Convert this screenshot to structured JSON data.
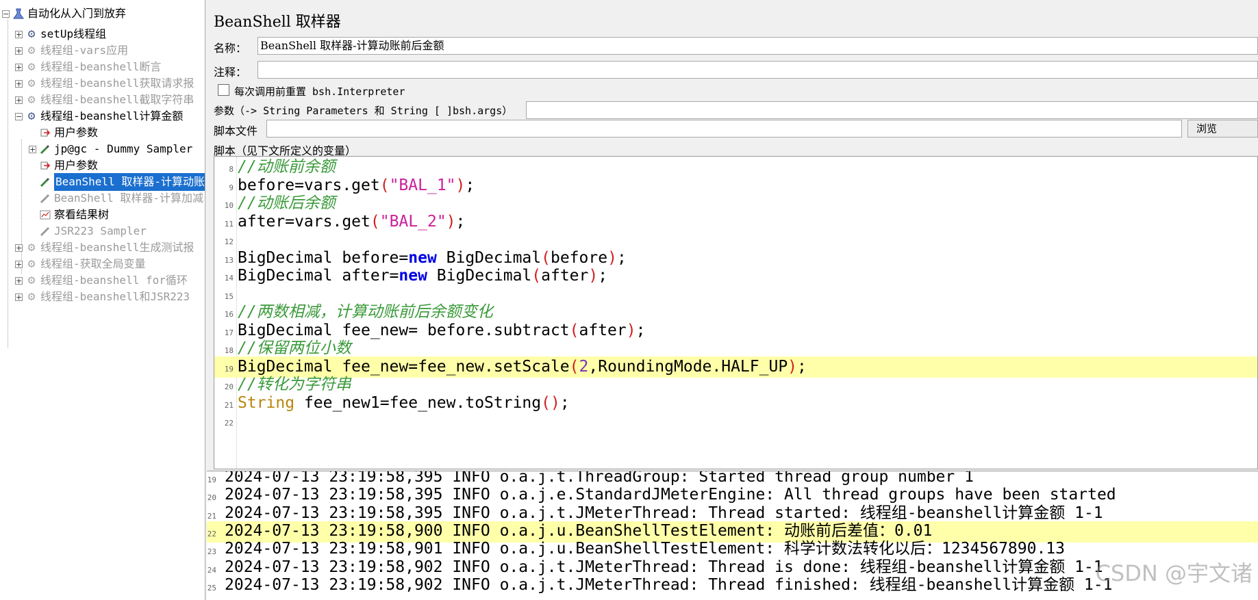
{
  "tree": {
    "root": "自动化从入门到放弃",
    "items": [
      {
        "label": "setUp线程组",
        "enabled": true
      },
      {
        "label": "线程组-vars应用",
        "enabled": false
      },
      {
        "label": "线程组-beanshell断言",
        "enabled": false
      },
      {
        "label": "线程组-beanshell获取请求报",
        "enabled": false
      },
      {
        "label": "线程组-beanshell截取字符串",
        "enabled": false
      },
      {
        "label": "线程组-beanshell计算金额",
        "enabled": true
      },
      {
        "label": "用户参数",
        "enabled": true
      },
      {
        "label": "jp@gc - Dummy Sampler",
        "enabled": true
      },
      {
        "label": "用户参数",
        "enabled": true
      },
      {
        "label": "BeanShell 取样器-计算动账",
        "enabled": true
      },
      {
        "label": "BeanShell 取样器-计算加减",
        "enabled": false
      },
      {
        "label": "察看结果树",
        "enabled": true
      },
      {
        "label": "JSR223 Sampler",
        "enabled": false
      },
      {
        "label": "线程组-beanshell生成测试报",
        "enabled": false
      },
      {
        "label": "线程组-获取全局变量",
        "enabled": false
      },
      {
        "label": "线程组-beanshell for循环",
        "enabled": false
      },
      {
        "label": "线程组-beanshell和JSR223",
        "enabled": false
      }
    ]
  },
  "panel": {
    "title": "BeanShell 取样器",
    "name_label": "名称：",
    "name_value": "BeanShell 取样器-计算动账前后金额",
    "comment_label": "注释：",
    "comment_value": "",
    "reset_label": "每次调用前重置 bsh.Interpreter",
    "params_label": "参数（-> String Parameters 和 String [ ]bsh.args）",
    "params_value": "",
    "script_file_label": "脚本文件",
    "script_file_value": "",
    "browse_label": "浏览",
    "script_label": "脚本（见下文所定义的变量）"
  },
  "editor": {
    "lines": [
      {
        "n": "8",
        "text": "//动账前余额"
      },
      {
        "n": "9",
        "text": "before=vars.get(\"BAL_1\");"
      },
      {
        "n": "10",
        "text": "//动账后余额"
      },
      {
        "n": "11",
        "text": "after=vars.get(\"BAL_2\");"
      },
      {
        "n": "12",
        "text": ""
      },
      {
        "n": "13",
        "text": "BigDecimal before=new BigDecimal(before);"
      },
      {
        "n": "14",
        "text": "BigDecimal after=new BigDecimal(after);"
      },
      {
        "n": "15",
        "text": ""
      },
      {
        "n": "16",
        "text": "//两数相减，计算动账前后余额变化"
      },
      {
        "n": "17",
        "text": "BigDecimal fee_new= before.subtract(after);"
      },
      {
        "n": "18",
        "text": "//保留两位小数"
      },
      {
        "n": "19",
        "text": "BigDecimal fee_new=fee_new.setScale(2,RoundingMode.HALF_UP);"
      },
      {
        "n": "20",
        "text": "//转化为字符串"
      },
      {
        "n": "21",
        "text": "String fee_new1=fee_new.toString();"
      },
      {
        "n": "22",
        "text": ""
      }
    ],
    "highlight_line": "19"
  },
  "log": {
    "lines": [
      {
        "n": "19",
        "text": "2024-07-13 23:19:58,395 INFO o.a.j.t.ThreadGroup: Started thread group number 1"
      },
      {
        "n": "20",
        "text": "2024-07-13 23:19:58,395 INFO o.a.j.e.StandardJMeterEngine: All thread groups have been started"
      },
      {
        "n": "21",
        "text": "2024-07-13 23:19:58,395 INFO o.a.j.t.JMeterThread: Thread started: 线程组-beanshell计算金额 1-1"
      },
      {
        "n": "22",
        "text": "2024-07-13 23:19:58,900 INFO o.a.j.u.BeanShellTestElement: 动账前后差值：0.01"
      },
      {
        "n": "23",
        "text": "2024-07-13 23:19:58,901 INFO o.a.j.u.BeanShellTestElement: 科学计数法转化以后：1234567890.13"
      },
      {
        "n": "24",
        "text": "2024-07-13 23:19:58,902 INFO o.a.j.t.JMeterThread: Thread is done: 线程组-beanshell计算金额 1-1"
      },
      {
        "n": "25",
        "text": "2024-07-13 23:19:58,902 INFO o.a.j.t.JMeterThread: Thread finished: 线程组-beanshell计算金额 1-1"
      }
    ],
    "highlight_line": "22"
  },
  "watermark": "CSDN @宇文诸"
}
